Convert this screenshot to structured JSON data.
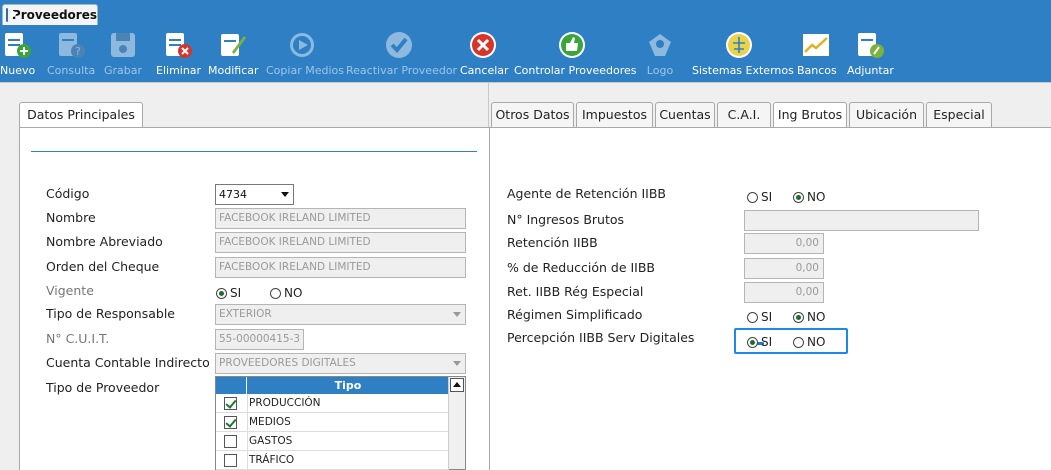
{
  "window": {
    "tab_title": "Proveedores"
  },
  "toolbar": {
    "buttons": [
      {
        "label": "Nuevo",
        "icon": "doc-plus-icon",
        "enabled": true
      },
      {
        "label": "Consulta",
        "icon": "doc-question-icon",
        "enabled": false
      },
      {
        "label": "Grabar",
        "icon": "save-icon",
        "enabled": false
      },
      {
        "label": "Eliminar",
        "icon": "doc-delete-icon",
        "enabled": true
      },
      {
        "label": "Modificar",
        "icon": "doc-edit-icon",
        "enabled": true
      },
      {
        "label": "Copiar Medios",
        "icon": "play-circle-icon",
        "enabled": false
      },
      {
        "label": "Reactivar Proveedor",
        "icon": "check-circle-icon",
        "enabled": false
      },
      {
        "label": "Cancelar",
        "icon": "cancel-circle-icon",
        "enabled": true
      },
      {
        "label": "Controlar Proveedores",
        "icon": "thumbs-up-icon",
        "enabled": true
      },
      {
        "label": "Logo",
        "icon": "logo-icon",
        "enabled": false
      },
      {
        "label": "Sistemas Externos",
        "icon": "external-systems-icon",
        "enabled": true
      },
      {
        "label": "Bancos",
        "icon": "chart-icon",
        "enabled": true
      },
      {
        "label": "Adjuntar",
        "icon": "attach-icon",
        "enabled": true
      }
    ]
  },
  "left": {
    "tab": "Datos Principales",
    "fields": {
      "codigo": {
        "label": "Código",
        "value": "4734"
      },
      "nombre": {
        "label": "Nombre",
        "value": "FACEBOOK IRELAND LIMITED"
      },
      "nombre_abreviado": {
        "label": "Nombre Abreviado",
        "value": "FACEBOOK IRELAND LIMITED"
      },
      "orden_cheque": {
        "label": "Orden del Cheque",
        "value": "FACEBOOK IRELAND LIMITED"
      },
      "vigente": {
        "label": "Vigente",
        "si": "SI",
        "no": "NO",
        "selected": "SI"
      },
      "tipo_responsable": {
        "label": "Tipo de Responsable",
        "value": "EXTERIOR"
      },
      "cuit": {
        "label": "N° C.U.I.T.",
        "value": "55-00000415-3"
      },
      "cuenta_contable": {
        "label": "Cuenta Contable Indirecto",
        "value": "PROVEEDORES DIGITALES"
      },
      "tipo_proveedor": {
        "label": "Tipo de Proveedor"
      }
    },
    "grid": {
      "header": "Tipo",
      "rows": [
        {
          "label": "PRODUCCIÓN",
          "checked": true
        },
        {
          "label": "MEDIOS",
          "checked": true
        },
        {
          "label": "GASTOS",
          "checked": false
        },
        {
          "label": "TRÁFICO",
          "checked": false
        }
      ]
    }
  },
  "right": {
    "tabs": [
      "Otros Datos",
      "Impuestos",
      "Cuentas",
      "C.A.I.",
      "Ing Brutos",
      "Ubicación",
      "Especial"
    ],
    "active_tab": "Ing Brutos",
    "fields": {
      "agente_retencion": {
        "label": "Agente de Retención IIBB",
        "si": "SI",
        "no": "NO",
        "selected": "NO"
      },
      "nro_ingresos_brutos": {
        "label": "N° Ingresos Brutos",
        "value": ""
      },
      "retencion": {
        "label": "Retención IIBB",
        "value": "0,00"
      },
      "pct_reduccion": {
        "label": "% de Reducción de IIBB",
        "value": "0,00"
      },
      "ret_reg_especial": {
        "label": "Ret. IIBB Rég Especial",
        "value": "0,00"
      },
      "regimen_simplificado": {
        "label": "Régimen Simplificado",
        "si": "SI",
        "no": "NO",
        "selected": "NO"
      },
      "percepcion_digitales": {
        "label": "Percepción IIBB Serv Digitales",
        "si": "SI",
        "no": "NO",
        "selected": "SI"
      }
    }
  },
  "colors": {
    "accent": "#2f7fc4",
    "highlight": "#1e88e5"
  }
}
